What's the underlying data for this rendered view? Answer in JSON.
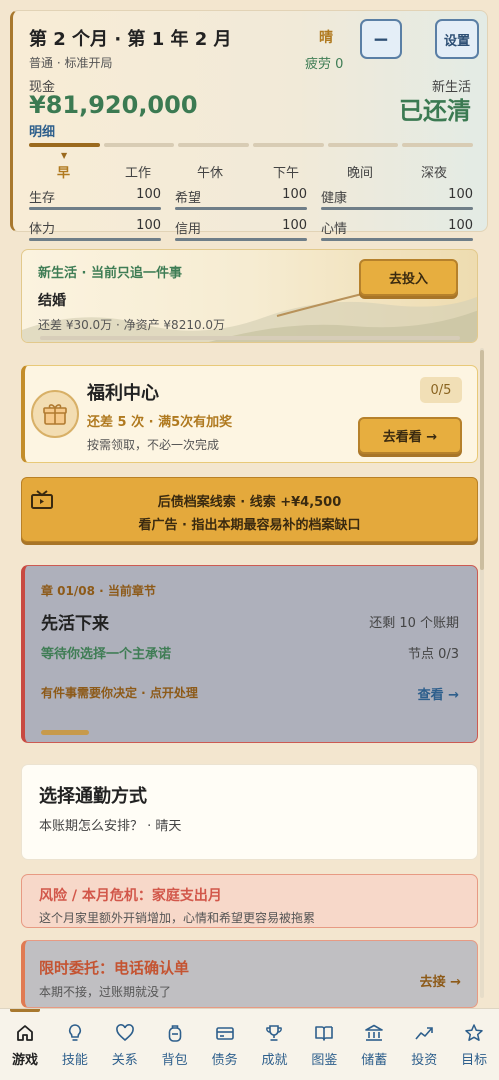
{
  "header": {
    "month_title": "第 2 个月 · 第 1 年 2 月",
    "weather": "晴",
    "fatigue": "疲劳 0",
    "minimize_label": "−",
    "settings_label": "设置",
    "mode": "普通 · 标准开局",
    "cash_label": "现金",
    "cash_value": "¥81,920,000",
    "detail_link": "明细",
    "new_life_label": "新生活",
    "new_life_value": "已还清"
  },
  "phases": {
    "current_index": 0,
    "items": [
      "早",
      "工作",
      "午休",
      "下午",
      "晚间",
      "深夜"
    ]
  },
  "stats": [
    {
      "name": "生存",
      "value": "100",
      "fill": 1.0
    },
    {
      "name": "希望",
      "value": "100",
      "fill": 1.0
    },
    {
      "name": "健康",
      "value": "100",
      "fill": 1.0
    },
    {
      "name": "体力",
      "value": "100",
      "fill": 1.0
    },
    {
      "name": "信用",
      "value": "100",
      "fill": 1.0
    },
    {
      "name": "心情",
      "value": "100",
      "fill": 1.0
    }
  ],
  "new_life": {
    "heading": "新生活 · 当前只追一件事",
    "goal": "结婚",
    "summary": "还差 ¥30.0万 · 净资产 ¥8210.0万",
    "button": "去投入"
  },
  "welfare": {
    "title": "福利中心",
    "subtitle": "还差 5 次 · 满5次有加奖",
    "note": "按需领取，不必一次完成",
    "count": "0/5",
    "button": "去看看 →"
  },
  "ad": {
    "line1": "后债档案线索 · 线索 +¥4,500",
    "line2": "看广告 · 指出本期最容易补的档案缺口"
  },
  "chapter": {
    "label": "章 01/08 · 当前章节",
    "title": "先活下来",
    "remaining": "还剩 10 个账期",
    "waiting": "等待你选择一个主承诺",
    "node": "节点 0/3",
    "decide": "有件事需要你决定 · 点开处理",
    "view": "查看 →"
  },
  "commute": {
    "title": "选择通勤方式",
    "subtitle": "本账期怎么安排？ · 晴天"
  },
  "risk": {
    "title": "风险 / 本月危机：家庭支出月",
    "subtitle": "这个月家里额外开销增加，心情和希望更容易被拖累"
  },
  "commission": {
    "title": "限时委托：电话确认单",
    "subtitle": "本期不接，过账期就没了",
    "accept": "去接 →"
  },
  "nav": {
    "active_index": 0,
    "items": [
      {
        "label": "游戏",
        "icon": "home-icon"
      },
      {
        "label": "技能",
        "icon": "lightbulb-icon"
      },
      {
        "label": "关系",
        "icon": "heart-icon"
      },
      {
        "label": "背包",
        "icon": "backpack-icon"
      },
      {
        "label": "债务",
        "icon": "card-icon"
      },
      {
        "label": "成就",
        "icon": "trophy-icon"
      },
      {
        "label": "图鉴",
        "icon": "book-icon"
      },
      {
        "label": "储蓄",
        "icon": "bank-icon"
      },
      {
        "label": "投资",
        "icon": "trend-icon"
      },
      {
        "label": "目标",
        "icon": "star-icon"
      }
    ]
  },
  "colors": {
    "accent_gold": "#e7ae3f",
    "accent_green": "#3b7a52",
    "accent_blue": "#2e5f8c",
    "danger_red": "#c84940"
  }
}
